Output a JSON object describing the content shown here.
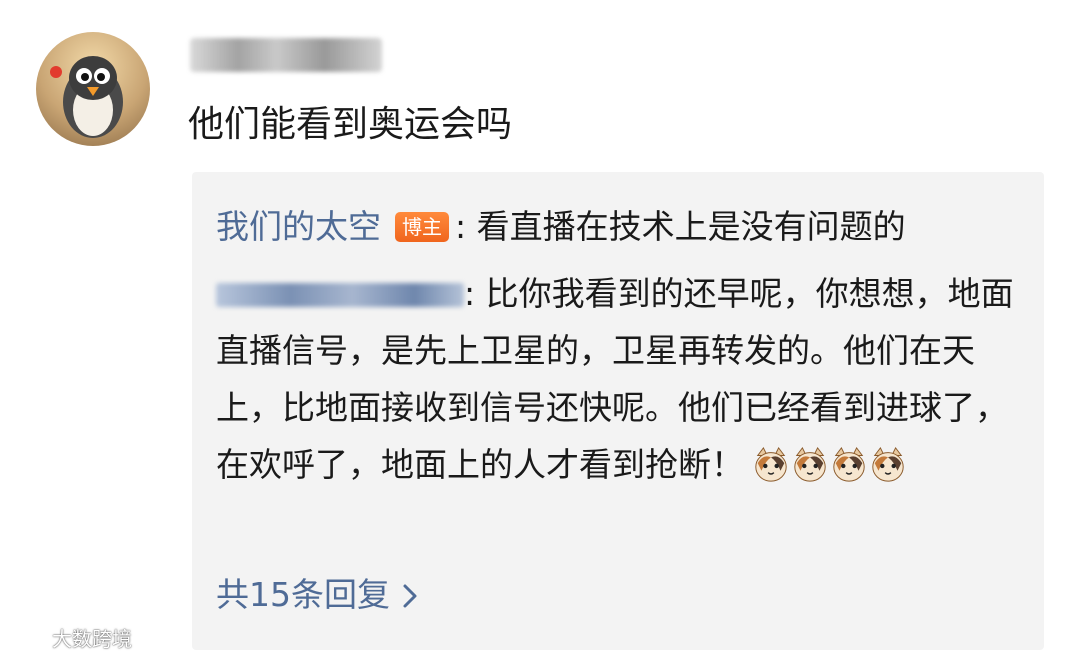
{
  "comment": {
    "text": "他们能看到奥运会吗"
  },
  "replies": [
    {
      "author": "我们的太空",
      "badge": "博主",
      "text": ": 看直播在技术上是没有问题的"
    },
    {
      "text": ": 比你我看到的还早呢，你想想，地面直播信号，是先上卫星的，卫星再转发的。他们在天上，比地面接收到信号还快呢。他们已经看到进球了，在欢呼了，地面上的人才看到抢断！"
    }
  ],
  "view_more": "共15条回复",
  "watermark": "大数跨境",
  "colors": {
    "link": "#4f6b96",
    "badge": "#f0651d",
    "reply_bg": "#f3f3f3"
  },
  "icons": {
    "emoji": "cat-face-emoji",
    "view_more": "chevron-right-icon"
  }
}
